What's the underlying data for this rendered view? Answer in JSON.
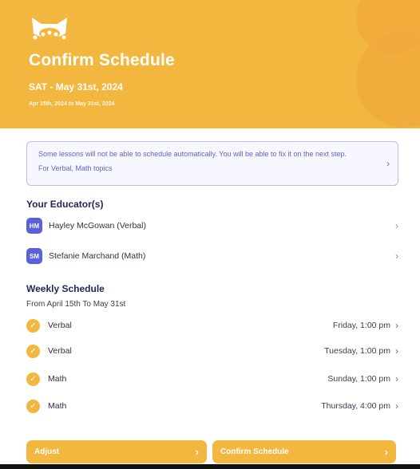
{
  "header": {
    "logo_icon": "cat-face-logo",
    "title": "Confirm Schedule",
    "date_main": "SAT - May 31st, 2024",
    "date_range": "Apr 15th, 2024 to May 31st, 2024"
  },
  "alert": {
    "line1": "Some lessons will not be able to schedule automatically. You will be able to fix it on the next step.",
    "line2": "For Verbal, Math topics"
  },
  "educators": {
    "title": "Your Educator(s)",
    "items": [
      {
        "initials": "HM",
        "name": "Hayley McGowan (Verbal)"
      },
      {
        "initials": "SM",
        "name": "Stefanie Marchand (Math)"
      }
    ]
  },
  "weekly": {
    "title": "Weekly Schedule",
    "subtitle": "From April 15th To May 31st",
    "items": [
      {
        "subject": "Verbal",
        "when": "Friday, 1:00 pm"
      },
      {
        "subject": "Verbal",
        "when": "Tuesday, 1:00 pm"
      },
      {
        "subject": "Math",
        "when": "Sunday, 1:00 pm"
      },
      {
        "subject": "Math",
        "when": "Thursday, 4:00 pm"
      }
    ]
  },
  "buttons": {
    "adjust": "Adjust",
    "confirm": "Confirm Schedule"
  },
  "colors": {
    "brand": "#f3b73f",
    "accent": "#5a5fe0",
    "heading": "#22285a"
  }
}
